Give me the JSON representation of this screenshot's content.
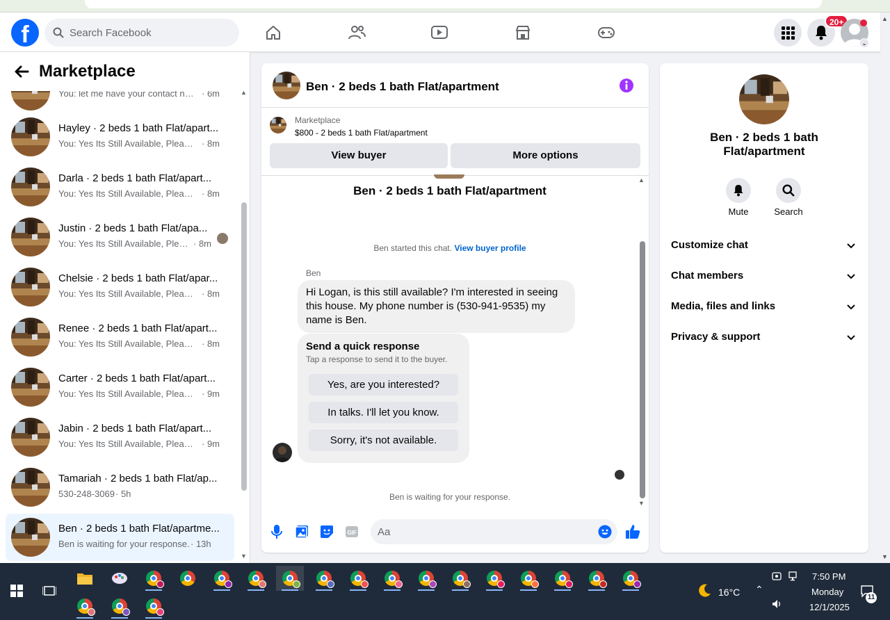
{
  "topbar": {
    "search_placeholder": "Search Facebook",
    "notifications_badge": "20+"
  },
  "left": {
    "title": "Marketplace",
    "conversations": [
      {
        "name": "",
        "snippet": "You: let me have your contact num...",
        "time": "· 6m"
      },
      {
        "name": "Hayley · 2 beds 1 bath Flat/apart...",
        "snippet": "You: Yes Its Still Available, Please S...",
        "time": "· 8m"
      },
      {
        "name": "Darla · 2 beds 1 bath Flat/apart...",
        "snippet": "You: Yes Its Still Available, Please S...",
        "time": "· 8m"
      },
      {
        "name": "Justin · 2 beds 1 bath Flat/apa...",
        "snippet": "You: Yes Its Still Available, Pleas...",
        "time": "· 8m"
      },
      {
        "name": "Chelsie · 2 beds 1 bath Flat/apar...",
        "snippet": "You: Yes Its Still Available, Please S...",
        "time": "· 8m"
      },
      {
        "name": "Renee · 2 beds 1 bath Flat/apart...",
        "snippet": "You: Yes Its Still Available, Please S...",
        "time": "· 8m"
      },
      {
        "name": "Carter · 2 beds 1 bath Flat/apart...",
        "snippet": "You: Yes Its Still Available, Please S...",
        "time": "· 9m"
      },
      {
        "name": "Jabin · 2 beds 1 bath Flat/apart...",
        "snippet": "You: Yes Its Still Available, Please S...",
        "time": "· 9m"
      },
      {
        "name": "Tamariah · 2 beds 1 bath Flat/ap...",
        "snippet": "530-248-3069",
        "time": "· 5h"
      },
      {
        "name": "Ben · 2 beds 1 bath Flat/apartme...",
        "snippet": "Ben is waiting for your response.",
        "time": "· 13h"
      }
    ]
  },
  "chat": {
    "title": "Ben · 2 beds 1 bath Flat/apartment",
    "listing_category": "Marketplace",
    "listing_price": "$800 - 2 beds 1 bath Flat/apartment",
    "view_buyer": "View buyer",
    "more_options": "More options",
    "thread_title": "Ben · 2 beds 1 bath Flat/apartment",
    "started_text": "Ben started this chat.",
    "started_link": "View buyer profile",
    "sender": "Ben",
    "message": "Hi Logan, is this still available? I'm interested in seeing this house. My phone number is (530-941-9535) my name is Ben.",
    "quick_title": "Send a quick response",
    "quick_sub": "Tap a response to send it to the buyer.",
    "quick_replies": [
      "Yes, are you interested?",
      "In talks. I'll let you know.",
      "Sorry, it's not available."
    ],
    "waiting": "Ben is waiting for your response.",
    "composer_placeholder": "Aa"
  },
  "right": {
    "name": "Ben · 2 beds 1 bath Flat/apartment",
    "mute": "Mute",
    "search": "Search",
    "sections": [
      "Customize chat",
      "Chat members",
      "Media, files and links",
      "Privacy & support"
    ]
  },
  "taskbar": {
    "temperature": "16°C",
    "time": "7:50 PM",
    "day": "Monday",
    "date": "12/1/2025",
    "notification_count": "11"
  },
  "colors": {
    "accent": "#0866ff",
    "link": "#0064d1",
    "info": "#a033ff",
    "badge": "#e41e3f"
  }
}
